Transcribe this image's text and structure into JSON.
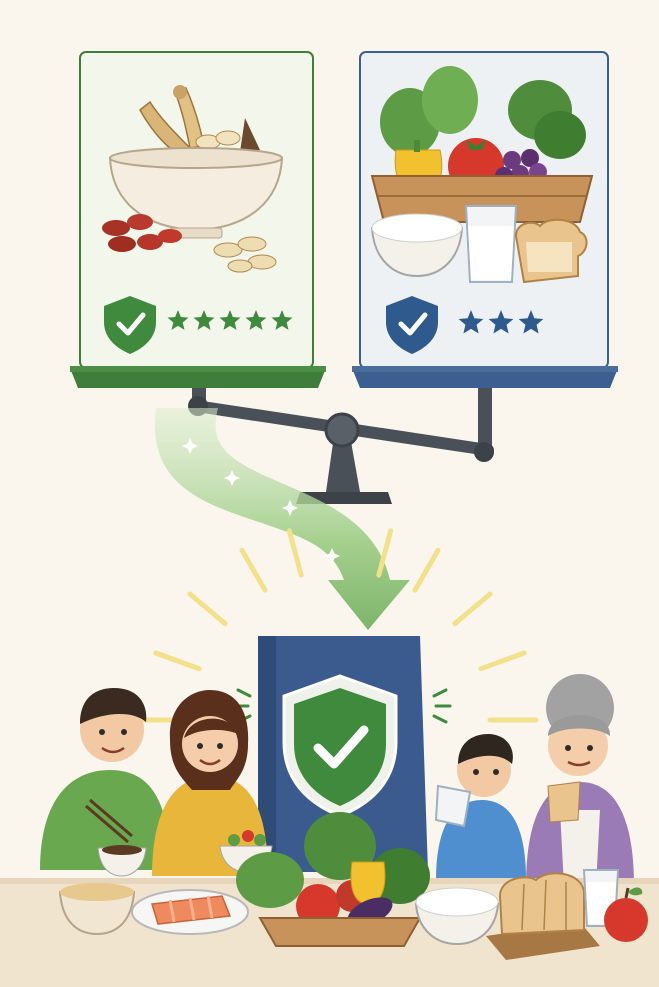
{
  "colors": {
    "background": "#faf6ee",
    "traditional_accent": "#3f7d3a",
    "traditional_panel": "#f3f6ea",
    "modern_accent": "#3d5f8f",
    "modern_panel": "#eef1f4",
    "shield_green": "#3f8a3c",
    "star_green": "#3f8a3c",
    "star_blue": "#2f5a8e",
    "book_blue": "#3b5b8e",
    "ray_yellow": "#f3e08a",
    "scale_gray": "#4a5057"
  },
  "panels": {
    "traditional": {
      "icon": "herbal-bowl-icon",
      "badge_icon": "shield-check-icon",
      "rating": 5
    },
    "modern": {
      "icon": "food-basket-icon",
      "badge_icon": "shield-check-icon",
      "rating": 3
    }
  },
  "balance": {
    "icon": "balance-scale-icon",
    "tilt": "left-down"
  },
  "arrow": {
    "icon": "curved-arrow-icon",
    "direction": "down",
    "sparkles": 4
  },
  "guide": {
    "icon": "shield-book-icon"
  },
  "family": {
    "members": [
      "father-figure",
      "mother-figure",
      "child-figure",
      "grandmother-figure"
    ]
  },
  "table_items": [
    "soup-bowl-icon",
    "salmon-plate-icon",
    "vegetable-basket-icon",
    "rice-bowl-icon",
    "bread-loaf-icon",
    "milk-glass-icon",
    "apple-icon"
  ]
}
